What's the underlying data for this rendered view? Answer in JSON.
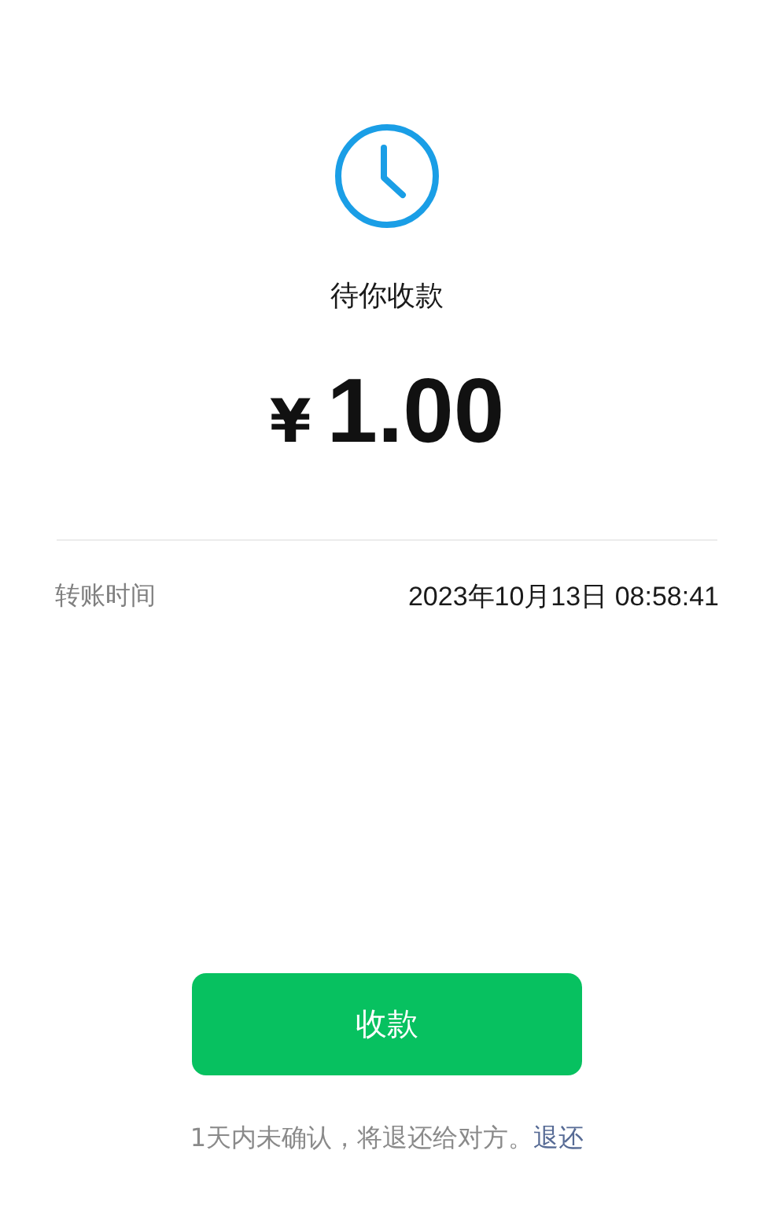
{
  "status": {
    "title": "待你收款"
  },
  "amount": {
    "currency": "¥",
    "value": "1.00"
  },
  "details": [
    {
      "label": "转账时间",
      "value": "2023年10月13日 08:58:41"
    }
  ],
  "button": {
    "label": "收款"
  },
  "notice": {
    "text": "1天内未确认，将退还给对方。",
    "link": "退还"
  }
}
